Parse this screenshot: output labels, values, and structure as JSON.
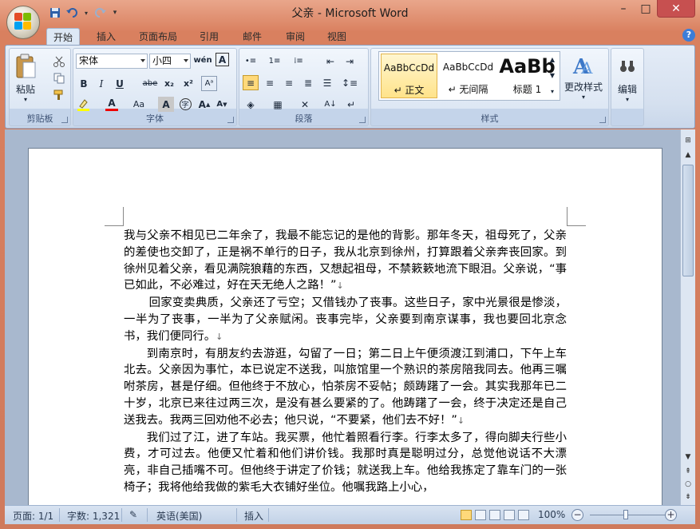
{
  "window": {
    "title": "父亲 - Microsoft Word",
    "controls": {
      "minimize": "–",
      "maximize": "□",
      "close": "✕"
    }
  },
  "quick_access": [
    {
      "name": "save-icon"
    },
    {
      "name": "undo-icon"
    },
    {
      "name": "redo-icon"
    },
    {
      "name": "customize-icon"
    }
  ],
  "tabs": [
    "开始",
    "插入",
    "页面布局",
    "引用",
    "邮件",
    "审阅",
    "视图"
  ],
  "active_tab": "开始",
  "ribbon": {
    "clipboard": {
      "label": "剪贴板",
      "paste": "粘贴"
    },
    "font": {
      "label": "字体",
      "font_name": "宋体",
      "font_size": "小四",
      "buttons": [
        "B",
        "I",
        "U",
        "abe",
        "x₂",
        "x²",
        "Aa",
        "A",
        "A",
        "Aa"
      ]
    },
    "paragraph": {
      "label": "段落"
    },
    "styles": {
      "label": "样式",
      "items": [
        {
          "sample": "AaBbCcDd",
          "name": "↵ 正文"
        },
        {
          "sample": "AaBbCcDd",
          "name": "↵ 无间隔"
        },
        {
          "sample": "AaBb",
          "name": "标题 1"
        }
      ],
      "change_styles": "更改样式"
    },
    "editing": {
      "label": "编辑"
    }
  },
  "document": {
    "paragraphs": [
      "我与父亲不相见已二年余了，我最不能忘记的是他的背影。那年冬天，祖母死了，父亲的差使也交卸了，正是祸不单行的日子，我从北京到徐州，打算跟着父亲奔丧回家。到徐州见着父亲，看见满院狼藉的东西，又想起祖母，不禁簌簌地流下眼泪。父亲说，“事已如此，不必难过，好在天无绝人之路！”",
      "回家变卖典质，父亲还了亏空；又借钱办了丧事。这些日子，家中光景很是惨淡，一半为了丧事，一半为了父亲赋闲。丧事完毕，父亲要到南京谋事，我也要回北京念书，我们便同行。",
      "到南京时，有朋友约去游逛，勾留了一日；第二日上午便须渡江到浦口，下午上车北去。父亲因为事忙，本已说定不送我，叫旅馆里一个熟识的茶房陪我同去。他再三嘱咐茶房，甚是仔细。但他终于不放心，怕茶房不妥帖；颇踌躇了一会。其实我那年已二十岁，北京已来往过两三次，是没有甚么要紧的了。他踌躇了一会，终于决定还是自己送我去。我两三回劝他不必去；他只说，“不要紧，他们去不好！”",
      "我们过了江，进了车站。我买票，他忙着照看行李。行李太多了，得向脚夫行些小费，才可过去。他便又忙着和他们讲价钱。我那时真是聪明过分，总觉他说话不大漂亮，非自己插嘴不可。但他终于讲定了价钱；就送我上车。他给我拣定了靠车门的一张椅子；我将他给我做的紫毛大衣铺好坐位。他嘱我路上小心，"
    ]
  },
  "statusbar": {
    "page": "页面: 1/1",
    "words": "字数: 1,321",
    "language": "英语(美国)",
    "mode": "插入",
    "zoom": "100%",
    "zoom_level_percent": 100
  }
}
